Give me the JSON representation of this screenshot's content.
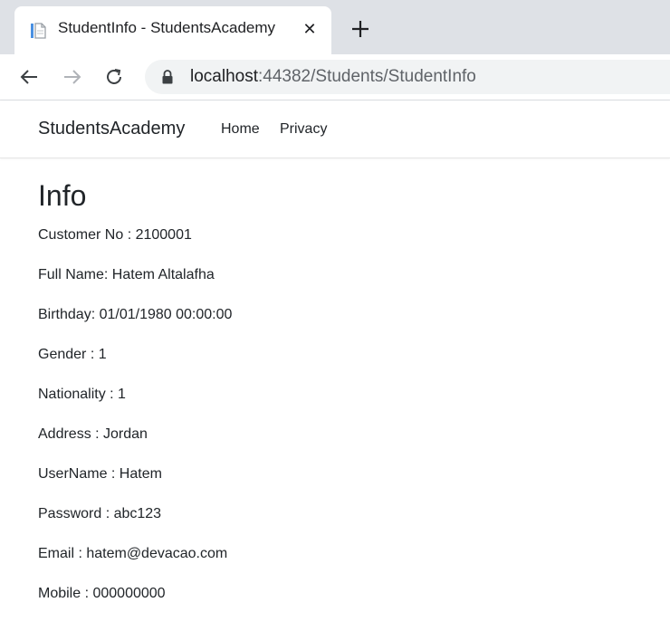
{
  "browser": {
    "tab_title": "StudentInfo - StudentsAcademy",
    "close_glyph": "✕",
    "url_host": "localhost",
    "url_path": ":44382/Students/StudentInfo"
  },
  "navbar": {
    "brand": "StudentsAcademy",
    "links": [
      {
        "label": "Home"
      },
      {
        "label": "Privacy"
      }
    ]
  },
  "page": {
    "title": "Info",
    "fields": [
      "Customer No : 2100001",
      "Full Name: Hatem Altalafha",
      "Birthday: 01/01/1980 00:00:00",
      "Gender : 1",
      "Nationality : 1",
      "Address : Jordan",
      "UserName : Hatem",
      "Password : abc123",
      "Email : hatem@devacao.com",
      "Mobile : 000000000"
    ]
  },
  "icons": {
    "favicon": "page-favicon-icon",
    "close": "close-icon",
    "new_tab": "plus-icon",
    "back": "arrow-left-icon",
    "forward": "arrow-right-icon",
    "reload": "reload-icon",
    "lock": "lock-icon"
  },
  "colors": {
    "tabstrip": "#dee1e6",
    "omnibox": "#f1f3f4",
    "text": "#212529",
    "favicon_accent": "#4a90e2"
  }
}
